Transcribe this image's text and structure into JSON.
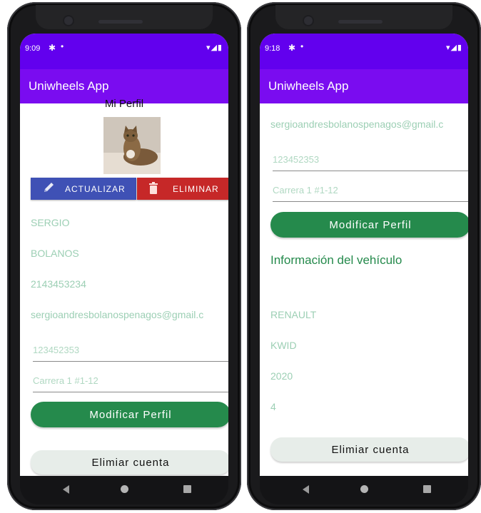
{
  "left_phone": {
    "status": {
      "time": "9:09",
      "gear": "✱",
      "dot": "•",
      "system": "▾◢▮"
    },
    "app_title": "Uniwheels App",
    "profile_title": "Mi Perfil",
    "update_label": "ACTUALIZAR",
    "delete_label": "ELIMINAR",
    "first_name": "SERGIO",
    "last_name": "BOLANOS",
    "id_number": "2143453234",
    "email": "sergioandresbolanospenagos@gmail.c",
    "phone_field": "123452353",
    "address_field": "Carrera 1 #1-12",
    "modify_button": "Modificar Perfil",
    "delete_account_button": "Elimiar cuenta"
  },
  "right_phone": {
    "status": {
      "time": "9:18",
      "gear": "✱",
      "dot": "•",
      "system": "▾◢▮"
    },
    "app_title": "Uniwheels App",
    "email": "sergioandresbolanospenagos@gmail.c",
    "phone_field": "123452353",
    "address_field": "Carrera 1 #1-12",
    "modify_button": "Modificar Perfil",
    "vehicle_section_title": "Información del vehículo",
    "vehicle_brand": "RENAULT",
    "vehicle_model": "KWID",
    "vehicle_year": "2020",
    "vehicle_seats": "4",
    "delete_account_button": "Elimiar cuenta"
  },
  "colors": {
    "status_bar": "#6200ee",
    "app_bar": "#7a0cf0",
    "primary_green": "#258a4c",
    "value_text": "#9ccfb4",
    "update_blue": "#3f51b5",
    "delete_red": "#c62828"
  }
}
